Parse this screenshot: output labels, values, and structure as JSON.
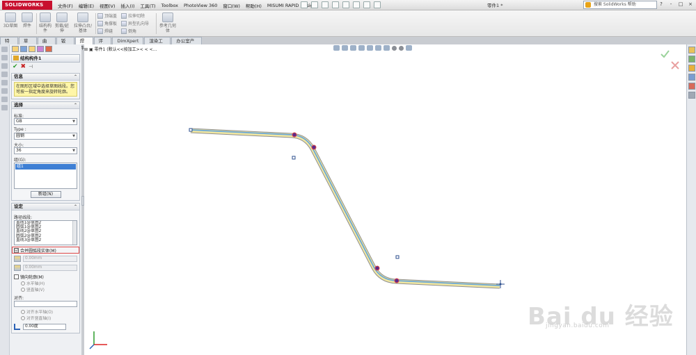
{
  "app": {
    "logo_text": "SOLIDWORKS",
    "menus": [
      "文件(F)",
      "编辑(E)",
      "视图(V)",
      "插入(I)",
      "工具(T)",
      "Toolbox",
      "PhotoView 360",
      "窗口(W)",
      "帮助(H)",
      "MISUMI RAPID Design"
    ],
    "document_title": "零件1 *",
    "help_search_placeholder": "搜索 SolidWorks 帮助",
    "window_controls": [
      "?",
      "-",
      "□",
      "×"
    ]
  },
  "ribbon": {
    "big_buttons": [
      "3D草图",
      "焊件",
      "结构构件",
      "剪裁/延伸",
      "拉伸凸台/基体"
    ],
    "small_col1": [
      "顶端盖",
      "角撑板",
      "焊缝"
    ],
    "small_col2": [
      "拉伸切除",
      "异型孔向导",
      "倒角"
    ],
    "ref_geom": "参考几何体"
  },
  "tabs": [
    "特征",
    "草图",
    "曲面",
    "钣金",
    "焊件",
    "评估",
    "DimXpert",
    "渲染工具",
    "办公室产品"
  ],
  "property_manager": {
    "title": "结构构件1",
    "info": {
      "header": "信息",
      "text": "在图形区域中选择草图线段。您可按一指定角度来旋转轮廓。"
    },
    "selection": {
      "header": "选择",
      "standard_label": "标准:",
      "standard_value": "GB",
      "type_label": "Type :",
      "type_value": "圆钢",
      "size_label": "大小:",
      "size_value": "36",
      "group_label": "组(G):",
      "group_selected": "组1",
      "new_group_button": "新组(N)"
    },
    "settings": {
      "header": "设定",
      "path_label": "路径线段:",
      "path_items": [
        "直线1@草图2",
        "圆弧1@草图2",
        "直线2@草图2",
        "圆弧2@草图2",
        "直线3@草图2"
      ],
      "merge_label": "合并圆弧段实体(M)",
      "merge_checked": "☑",
      "spin1": "0.00mm",
      "spin2": "0.00mm",
      "mirror_label": "镜向轮廓(M)",
      "horizontal_axis": "水平轴(H)",
      "vertical_axis": "竖直轴(V)",
      "align_label": "对齐:",
      "align_h": "对齐水平轴(O)",
      "align_v": "对齐竖直轴(I)",
      "angle_value": "0.00度"
    }
  },
  "graphics": {
    "tree_label": "零件1 (默认<<按加工>< < <...",
    "path_color": "#6aa8d8",
    "profile_color": "#f0e6a0"
  },
  "watermark": {
    "logo": "Bai du 经验",
    "url": "jingyan.baidu.com"
  }
}
